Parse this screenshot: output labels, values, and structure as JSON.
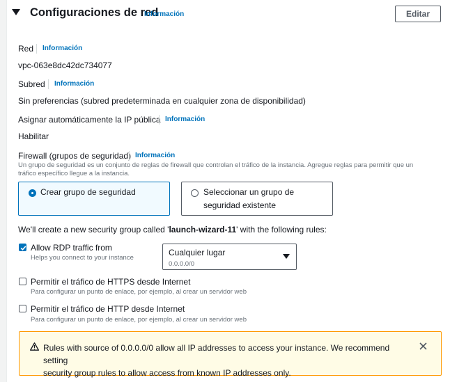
{
  "section": {
    "title": "Configuraciones de red",
    "info_label": "Información",
    "edit_label": "Editar"
  },
  "fields": {
    "network": {
      "label": "Red",
      "info": "Información",
      "value": "vpc-063e8dc42dc734077"
    },
    "subnet": {
      "label": "Subred",
      "info": "Información",
      "value": "Sin preferencias (subred predeterminada en cualquier zona de disponibilidad)"
    },
    "public_ip": {
      "label": "Asignar automáticamente la IP pública",
      "info": "Información",
      "value": "Habilitar"
    },
    "firewall": {
      "label": "Firewall (grupos de seguridad)",
      "info": "Información",
      "description_line1": "Un grupo de seguridad es un conjunto de reglas de firewall que controlan el tráfico de la instancia. Agregue reglas para permitir que un",
      "description_line2": "tráfico específico llegue a la instancia."
    }
  },
  "security_group_options": {
    "create": {
      "label": "Crear grupo de seguridad",
      "selected": true
    },
    "existing": {
      "label_line1": "Seleccionar un grupo de",
      "label_line2": "seguridad existente",
      "selected": false
    }
  },
  "rules_intro": {
    "prefix": "We'll create a new security group called '",
    "group_name": "launch-wizard-11",
    "suffix": "' with the following rules:"
  },
  "rules": {
    "rdp": {
      "label": "Allow RDP traffic from",
      "description": "Helps you connect to your instance",
      "checked": true
    },
    "rdp_source": {
      "value": "Cualquier lugar",
      "sub": "0.0.0.0/0"
    },
    "https": {
      "label": "Permitir el tráfico de HTTPS desde Internet",
      "description": "Para configurar un punto de enlace, por ejemplo, al crear un servidor web",
      "checked": false
    },
    "http": {
      "label": "Permitir el tráfico de HTTP desde Internet",
      "description": "Para configurar un punto de enlace, por ejemplo, al crear un servidor web",
      "checked": false
    }
  },
  "warning": {
    "text_line1": "Rules with source of 0.0.0.0/0 allow all IP addresses to access your instance. We recommend setting",
    "text_line2": "security group rules to allow access from known IP addresses only."
  },
  "colors": {
    "accent": "#0073bb",
    "warning_border": "#ff9900",
    "warning_bg": "#fffce6"
  },
  "icons": {
    "collapse": "caret-down-icon",
    "warning": "warning-icon",
    "close": "close-icon",
    "dropdown": "dropdown-caret-icon"
  }
}
